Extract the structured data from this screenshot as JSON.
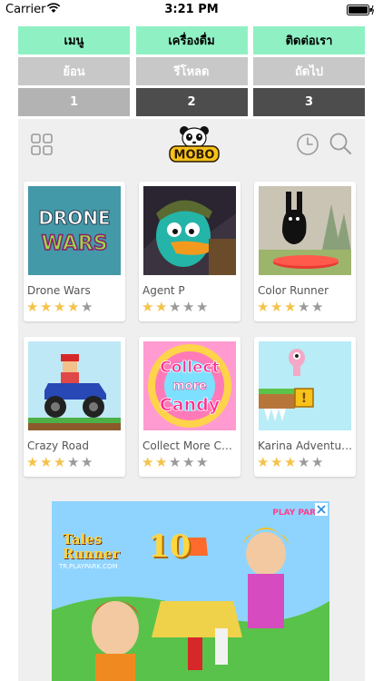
{
  "status": {
    "carrier": "Carrier",
    "time": "3:21 PM"
  },
  "nav": {
    "menu": "เมนู",
    "drinks": "เครื่องดื่ม",
    "contact": "ติดต่อเรา"
  },
  "controls": {
    "back": "ย้อน",
    "reload": "รีโหลด",
    "next": "ถัดไป"
  },
  "pages": [
    "1",
    "2",
    "3"
  ],
  "games": [
    {
      "title": "Drone Wars",
      "rating": 4
    },
    {
      "title": "Agent P",
      "rating": 2
    },
    {
      "title": "Color Runner",
      "rating": 3
    },
    {
      "title": "Crazy Road",
      "rating": 3
    },
    {
      "title": "Collect More Candy",
      "rating": 2
    },
    {
      "title": "Karina Adventures",
      "rating": 3
    }
  ],
  "thumbs": {
    "drone_text1": "DRONE",
    "drone_text2": "WARS",
    "candy_text1": "Collect",
    "candy_text2": "more",
    "candy_text3": "Candy"
  },
  "ad": {
    "title_line1": "Tales",
    "title_line2": "Runner",
    "url": "TR.PLAYPARK.COM",
    "anniversary": "10",
    "brand": "PLAY PARK"
  },
  "colors": {
    "nav_bg": "#8ff0c4",
    "control_bg": "#c8c8c8",
    "page_bg": "#4d4d4d",
    "star": "#f5c24a"
  }
}
